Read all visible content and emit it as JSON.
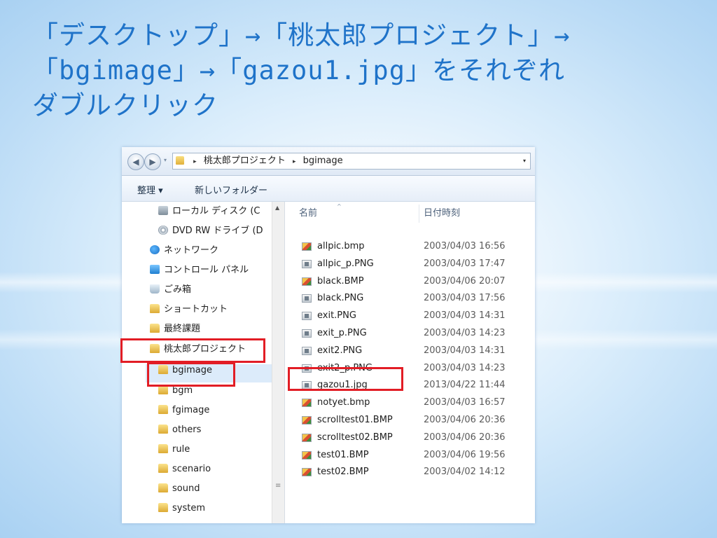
{
  "slide": {
    "title_lines": [
      "「デスクトップ」→「桃太郎プロジェクト」→",
      "「bgimage」→「gazou1.jpg」をそれぞれ",
      "ダブルクリック"
    ],
    "title_color": "#1f73c9",
    "callout_color": "#e21d25"
  },
  "explorer": {
    "nav_buttons": {
      "back_icon": "arrow-left-icon",
      "forward_icon": "arrow-right-icon"
    },
    "breadcrumb": {
      "sep": "▸",
      "items": [
        "桃太郎プロジェクト",
        "bgimage"
      ],
      "dropdown": "▾"
    },
    "toolbar": {
      "organize_label": "整理 ▾",
      "new_folder_label": "新しいフォルダー"
    },
    "nav_items": [
      {
        "label": "ローカル ディスク (C",
        "icon": "disk-icon"
      },
      {
        "label": "DVD RW ドライブ (D",
        "icon": "dvd-icon"
      },
      {
        "label": "ネットワーク",
        "icon": "network-icon"
      },
      {
        "label": "コントロール パネル",
        "icon": "control-panel-icon"
      },
      {
        "label": "ごみ箱",
        "icon": "trash-icon"
      },
      {
        "label": "ショートカット",
        "icon": "folder-icon"
      },
      {
        "label": "最終課題",
        "icon": "folder-icon"
      },
      {
        "label": "桃太郎プロジェクト",
        "icon": "folder-icon"
      },
      {
        "label": "bgimage",
        "icon": "folder-icon",
        "selected": true
      },
      {
        "label": "bgm",
        "icon": "folder-icon"
      },
      {
        "label": "fgimage",
        "icon": "folder-icon"
      },
      {
        "label": "others",
        "icon": "folder-icon"
      },
      {
        "label": "rule",
        "icon": "folder-icon"
      },
      {
        "label": "scenario",
        "icon": "folder-icon"
      },
      {
        "label": "sound",
        "icon": "folder-icon"
      },
      {
        "label": "system",
        "icon": "folder-icon"
      }
    ],
    "columns": {
      "name": "名前",
      "date": "日付時刻"
    },
    "files": [
      {
        "name": "allpic.bmp",
        "date": "2003/04/03 16:56",
        "type": "bmp"
      },
      {
        "name": "allpic_p.PNG",
        "date": "2003/04/03 17:47",
        "type": "png"
      },
      {
        "name": "black.BMP",
        "date": "2003/04/06 20:07",
        "type": "bmp"
      },
      {
        "name": "black.PNG",
        "date": "2003/04/03 17:56",
        "type": "png"
      },
      {
        "name": "exit.PNG",
        "date": "2003/04/03 14:31",
        "type": "png"
      },
      {
        "name": "exit_p.PNG",
        "date": "2003/04/03 14:23",
        "type": "png"
      },
      {
        "name": "exit2.PNG",
        "date": "2003/04/03 14:31",
        "type": "png"
      },
      {
        "name": "exit2_p.PNG",
        "date": "2003/04/03 14:23",
        "type": "png"
      },
      {
        "name": "gazou1.jpg",
        "date": "2013/04/22 11:44",
        "type": "png"
      },
      {
        "name": "notyet.bmp",
        "date": "2003/04/03 16:57",
        "type": "bmp"
      },
      {
        "name": "scrolltest01.BMP",
        "date": "2003/04/06 20:36",
        "type": "bmp"
      },
      {
        "name": "scrolltest02.BMP",
        "date": "2003/04/06 20:36",
        "type": "bmp"
      },
      {
        "name": "test01.BMP",
        "date": "2003/04/06 19:56",
        "type": "bmp"
      },
      {
        "name": "test02.BMP",
        "date": "2003/04/02 14:12",
        "type": "bmp"
      }
    ]
  }
}
